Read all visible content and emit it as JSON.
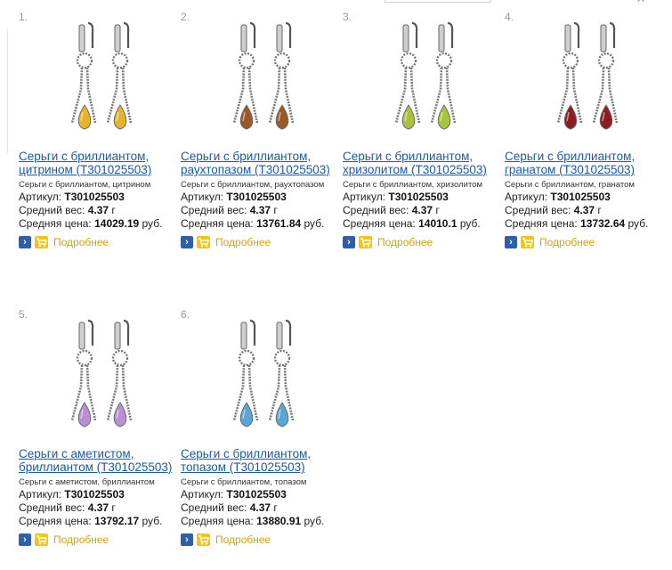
{
  "products": [
    {
      "num": "1.",
      "title": "Серьги с бриллиантом, цитрином (Т301025503)",
      "desc": "Серьги с бриллиантом, цитрином",
      "article_label": "Артикул:",
      "article": "Т301025503",
      "weight_label": "Средний вес:",
      "weight": "4.37",
      "weight_unit": "г",
      "price_label": "Средняя цена:",
      "price": "14029.19",
      "price_unit": "руб.",
      "more": "Подробнее",
      "stone_color": "#e7b52a"
    },
    {
      "num": "2.",
      "title": "Серьги с бриллиантом, раухтопазом (Т301025503)",
      "desc": "Серьги с бриллиантом, раухтопазом",
      "article_label": "Артикул:",
      "article": "Т301025503",
      "weight_label": "Средний вес:",
      "weight": "4.37",
      "weight_unit": "г",
      "price_label": "Средняя цена:",
      "price": "13761.84",
      "price_unit": "руб.",
      "more": "Подробнее",
      "stone_color": "#9a5a25"
    },
    {
      "num": "3.",
      "title": "Серьги с бриллиантом, хризолитом (Т301025503)",
      "desc": "Серьги с бриллиантом, хризолитом",
      "article_label": "Артикул:",
      "article": "Т301025503",
      "weight_label": "Средний вес:",
      "weight": "4.37",
      "weight_unit": "г",
      "price_label": "Средняя цена:",
      "price": "14010.1",
      "price_unit": "руб.",
      "more": "Подробнее",
      "stone_color": "#a9c43a"
    },
    {
      "num": "4.",
      "title": "Серьги с бриллиантом, гранатом (Т301025503)",
      "desc": "Серьги с бриллиантом, гранатом",
      "article_label": "Артикул:",
      "article": "Т301025503",
      "weight_label": "Средний вес:",
      "weight": "4.37",
      "weight_unit": "г",
      "price_label": "Средняя цена:",
      "price": "13732.64",
      "price_unit": "руб.",
      "more": "Подробнее",
      "stone_color": "#8e1c22"
    },
    {
      "num": "5.",
      "title": "Серьги с аметистом, бриллиантом (Т301025503)",
      "desc": "Серьги с аметистом, бриллиантом",
      "article_label": "Артикул:",
      "article": "Т301025503",
      "weight_label": "Средний вес:",
      "weight": "4.37",
      "weight_unit": "г",
      "price_label": "Средняя цена:",
      "price": "13792.17",
      "price_unit": "руб.",
      "more": "Подробнее",
      "stone_color": "#b98fd6"
    },
    {
      "num": "6.",
      "title": "Серьги с бриллиантом, топазом (Т301025503)",
      "desc": "Серьги с бриллиантом, топазом",
      "article_label": "Артикул:",
      "article": "Т301025503",
      "weight_label": "Средний вес:",
      "weight": "4.37",
      "weight_unit": "г",
      "price_label": "Средняя цена:",
      "price": "13880.91",
      "price_unit": "руб.",
      "more": "Подробнее",
      "stone_color": "#5aa6d4"
    }
  ]
}
